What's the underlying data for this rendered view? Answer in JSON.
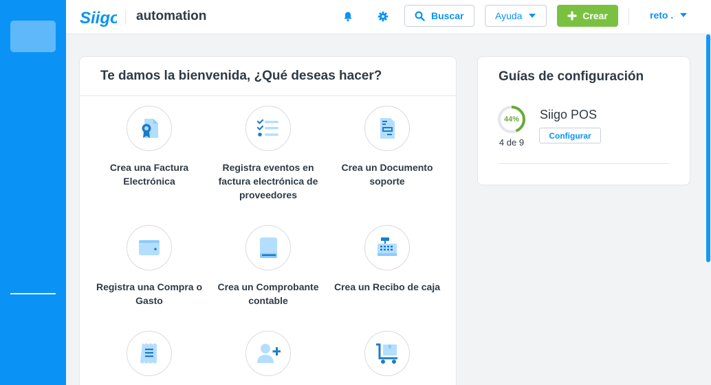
{
  "header": {
    "company_name": "automation",
    "search_label": "Buscar",
    "help_label": "Ayuda",
    "create_label": "Crear",
    "user_label": "reto ."
  },
  "welcome": {
    "title": "Te damos la bienvenida, ¿Qué deseas hacer?",
    "actions": [
      {
        "label": "Crea una Factura Electrónica",
        "icon": "certificate-document-icon"
      },
      {
        "label": "Registra eventos en factura electrónica de proveedores",
        "icon": "checklist-icon"
      },
      {
        "label": "Crea un Documento soporte",
        "icon": "support-document-icon"
      },
      {
        "label": "Registra una Compra o Gasto",
        "icon": "wallet-icon"
      },
      {
        "label": "Crea un Comprobante contable",
        "icon": "accounting-book-icon"
      },
      {
        "label": "Crea un Recibo de caja",
        "icon": "cash-register-icon"
      },
      {
        "label": "",
        "icon": "receipt-icon"
      },
      {
        "label": "",
        "icon": "add-user-icon"
      },
      {
        "label": "",
        "icon": "inventory-cart-icon"
      }
    ]
  },
  "guides": {
    "title": "Guías de configuración",
    "items": [
      {
        "name": "Siigo POS",
        "progress_label": "44%",
        "progress": 0.44,
        "count": "4 de 9",
        "button_label": "Configurar"
      }
    ]
  },
  "colors": {
    "primary": "#0a93f5",
    "green": "#7ac142",
    "icon_light": "#b3deff",
    "icon_dark": "#1b7cc9"
  }
}
